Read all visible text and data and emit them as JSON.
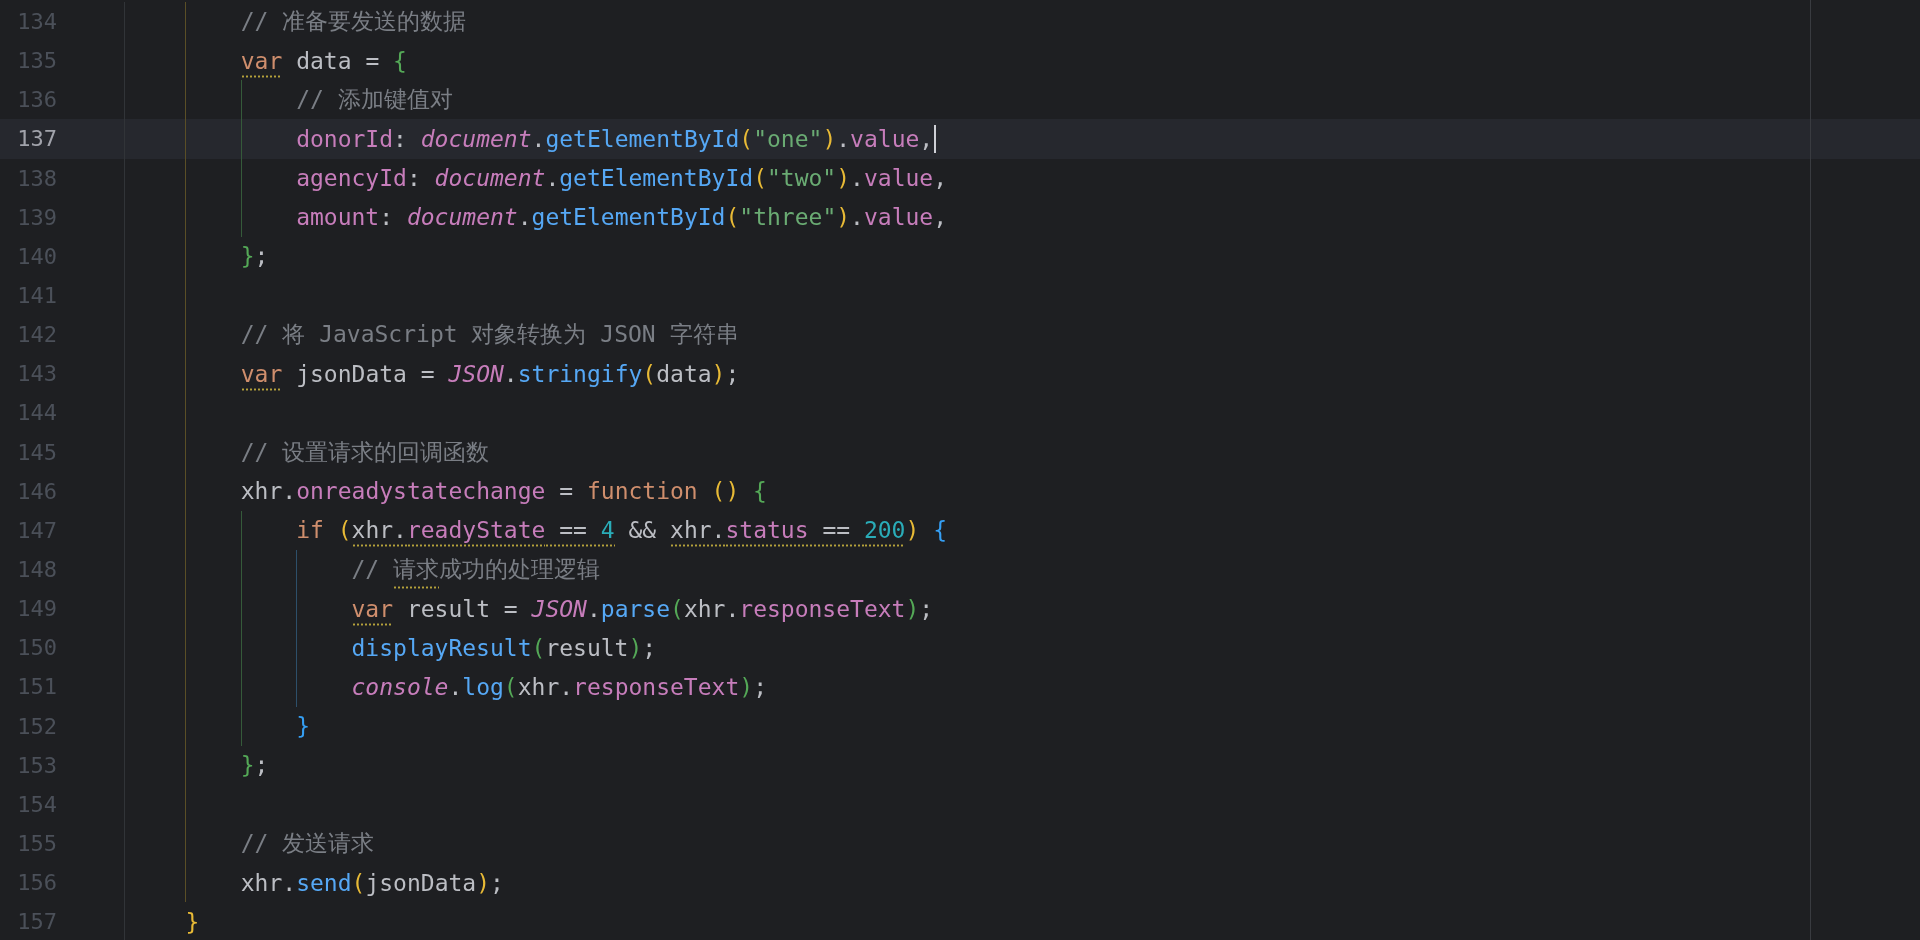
{
  "function_body": {
    "lines": [
      {
        "number": "134",
        "current": false,
        "tokens": [
          {
            "kind": "comment",
            "text": "// 准备要发送的数据",
            "warn": false
          }
        ]
      },
      {
        "number": "135",
        "current": false,
        "tokens": [
          {
            "kind": "keyword",
            "text": "var",
            "warn": true
          },
          {
            "kind": "plain",
            "text": " data = ",
            "warn": false
          },
          {
            "kind": "paren2",
            "text": "{",
            "warn": false
          }
        ],
        "children": [
          {
            "number": "136",
            "current": false,
            "tokens": [
              {
                "kind": "comment",
                "text": "// 添加键值对",
                "warn": false
              }
            ]
          },
          {
            "number": "137",
            "current": true,
            "tokens": [
              {
                "kind": "field",
                "text": "donorId",
                "warn": false
              },
              {
                "kind": "plain",
                "text": ": ",
                "warn": false
              },
              {
                "kind": "global",
                "text": "document",
                "warn": false
              },
              {
                "kind": "plain",
                "text": ".",
                "warn": false
              },
              {
                "kind": "method",
                "text": "getElementById",
                "warn": false
              },
              {
                "kind": "paren1",
                "text": "(",
                "warn": false
              },
              {
                "kind": "string",
                "text": "\"one\"",
                "warn": false
              },
              {
                "kind": "paren1",
                "text": ")",
                "warn": false
              },
              {
                "kind": "plain",
                "text": ".",
                "warn": false
              },
              {
                "kind": "field",
                "text": "value",
                "warn": false
              },
              {
                "kind": "plain",
                "text": ",",
                "warn": false
              }
            ]
          },
          {
            "number": "138",
            "current": false,
            "tokens": [
              {
                "kind": "field",
                "text": "agencyId",
                "warn": false
              },
              {
                "kind": "plain",
                "text": ": ",
                "warn": false
              },
              {
                "kind": "global",
                "text": "document",
                "warn": false
              },
              {
                "kind": "plain",
                "text": ".",
                "warn": false
              },
              {
                "kind": "method",
                "text": "getElementById",
                "warn": false
              },
              {
                "kind": "paren1",
                "text": "(",
                "warn": false
              },
              {
                "kind": "string",
                "text": "\"two\"",
                "warn": false
              },
              {
                "kind": "paren1",
                "text": ")",
                "warn": false
              },
              {
                "kind": "plain",
                "text": ".",
                "warn": false
              },
              {
                "kind": "field",
                "text": "value",
                "warn": false
              },
              {
                "kind": "plain",
                "text": ",",
                "warn": false
              }
            ]
          },
          {
            "number": "139",
            "current": false,
            "tokens": [
              {
                "kind": "field",
                "text": "amount",
                "warn": false
              },
              {
                "kind": "plain",
                "text": ": ",
                "warn": false
              },
              {
                "kind": "global",
                "text": "document",
                "warn": false
              },
              {
                "kind": "plain",
                "text": ".",
                "warn": false
              },
              {
                "kind": "method",
                "text": "getElementById",
                "warn": false
              },
              {
                "kind": "paren1",
                "text": "(",
                "warn": false
              },
              {
                "kind": "string",
                "text": "\"three\"",
                "warn": false
              },
              {
                "kind": "paren1",
                "text": ")",
                "warn": false
              },
              {
                "kind": "plain",
                "text": ".",
                "warn": false
              },
              {
                "kind": "field",
                "text": "value",
                "warn": false
              },
              {
                "kind": "plain",
                "text": ",",
                "warn": false
              }
            ]
          }
        ]
      },
      {
        "number": "140",
        "current": false,
        "tokens": [
          {
            "kind": "paren2",
            "text": "}",
            "warn": false
          },
          {
            "kind": "plain",
            "text": ";",
            "warn": false
          }
        ]
      },
      {
        "number": "141",
        "current": false
      },
      {
        "number": "142",
        "current": false,
        "tokens": [
          {
            "kind": "comment",
            "text": "// 将 JavaScript 对象转换为 JSON 字符串",
            "warn": false
          }
        ]
      },
      {
        "number": "143",
        "current": false,
        "tokens": [
          {
            "kind": "keyword",
            "text": "var",
            "warn": true
          },
          {
            "kind": "plain",
            "text": " jsonData = ",
            "warn": false
          },
          {
            "kind": "global",
            "text": "JSON",
            "warn": false
          },
          {
            "kind": "plain",
            "text": ".",
            "warn": false
          },
          {
            "kind": "method",
            "text": "stringify",
            "warn": false
          },
          {
            "kind": "paren1",
            "text": "(",
            "warn": false
          },
          {
            "kind": "plain",
            "text": "data",
            "warn": false
          },
          {
            "kind": "paren1",
            "text": ")",
            "warn": false
          },
          {
            "kind": "plain",
            "text": ";",
            "warn": false
          }
        ]
      },
      {
        "number": "144",
        "current": false
      },
      {
        "number": "145",
        "current": false,
        "tokens": [
          {
            "kind": "comment",
            "text": "// 设置请求的回调函数",
            "warn": false
          }
        ]
      },
      {
        "number": "146",
        "current": false,
        "tokens": [
          {
            "kind": "plain",
            "text": "xhr.",
            "warn": false
          },
          {
            "kind": "field",
            "text": "onreadystatechange",
            "warn": false
          },
          {
            "kind": "plain",
            "text": " = ",
            "warn": false
          },
          {
            "kind": "keyword",
            "text": "function",
            "warn": false
          },
          {
            "kind": "paren1",
            "text": " ()",
            "warn": false
          },
          {
            "kind": "paren2",
            "text": " {",
            "warn": false
          }
        ],
        "children": [
          {
            "number": "147",
            "current": false,
            "tokens": [
              {
                "kind": "keyword",
                "text": "if",
                "warn": false
              },
              {
                "kind": "paren1",
                "text": " (",
                "warn": false
              },
              {
                "kind": "plain",
                "text": "xhr.",
                "warn": true
              },
              {
                "kind": "field",
                "text": "readyState",
                "warn": true
              },
              {
                "kind": "plain",
                "text": " == ",
                "warn": true
              },
              {
                "kind": "number",
                "text": "4",
                "warn": true
              },
              {
                "kind": "plain",
                "text": " && ",
                "warn": false
              },
              {
                "kind": "plain",
                "text": "xhr.",
                "warn": true
              },
              {
                "kind": "field",
                "text": "status",
                "warn": true
              },
              {
                "kind": "plain",
                "text": " == ",
                "warn": true
              },
              {
                "kind": "number",
                "text": "200",
                "warn": true
              },
              {
                "kind": "paren1",
                "text": ")",
                "warn": false
              },
              {
                "kind": "paren3",
                "text": " {",
                "warn": false
              }
            ],
            "children": [
              {
                "number": "148",
                "current": false,
                "tokens": [
                  {
                    "kind": "comment",
                    "text": "// ",
                    "warn": false
                  },
                  {
                    "kind": "comment",
                    "text": "请求",
                    "warn": true
                  },
                  {
                    "kind": "comment",
                    "text": "成功的处理逻辑",
                    "warn": false
                  }
                ]
              },
              {
                "number": "149",
                "current": false,
                "tokens": [
                  {
                    "kind": "keyword",
                    "text": "var",
                    "warn": true
                  },
                  {
                    "kind": "plain",
                    "text": " result = ",
                    "warn": false
                  },
                  {
                    "kind": "global",
                    "text": "JSON",
                    "warn": false
                  },
                  {
                    "kind": "plain",
                    "text": ".",
                    "warn": false
                  },
                  {
                    "kind": "method",
                    "text": "parse",
                    "warn": false
                  },
                  {
                    "kind": "paren2",
                    "text": "(",
                    "warn": false
                  },
                  {
                    "kind": "plain",
                    "text": "xhr.",
                    "warn": false
                  },
                  {
                    "kind": "field",
                    "text": "responseText",
                    "warn": false
                  },
                  {
                    "kind": "paren2",
                    "text": ")",
                    "warn": false
                  },
                  {
                    "kind": "plain",
                    "text": ";",
                    "warn": false
                  }
                ]
              },
              {
                "number": "150",
                "current": false,
                "tokens": [
                  {
                    "kind": "method",
                    "text": "displayResult",
                    "warn": false
                  },
                  {
                    "kind": "paren2",
                    "text": "(",
                    "warn": false
                  },
                  {
                    "kind": "plain",
                    "text": "result",
                    "warn": false
                  },
                  {
                    "kind": "paren2",
                    "text": ")",
                    "warn": false
                  },
                  {
                    "kind": "plain",
                    "text": ";",
                    "warn": false
                  }
                ]
              },
              {
                "number": "151",
                "current": false,
                "tokens": [
                  {
                    "kind": "global",
                    "text": "console",
                    "warn": false
                  },
                  {
                    "kind": "plain",
                    "text": ".",
                    "warn": false
                  },
                  {
                    "kind": "method",
                    "text": "log",
                    "warn": false
                  },
                  {
                    "kind": "paren2",
                    "text": "(",
                    "warn": false
                  },
                  {
                    "kind": "plain",
                    "text": "xhr.",
                    "warn": false
                  },
                  {
                    "kind": "field",
                    "text": "responseText",
                    "warn": false
                  },
                  {
                    "kind": "paren2",
                    "text": ")",
                    "warn": false
                  },
                  {
                    "kind": "plain",
                    "text": ";",
                    "warn": false
                  }
                ]
              }
            ]
          },
          {
            "number": "152",
            "current": false,
            "tokens": [
              {
                "kind": "paren3",
                "text": "}",
                "warn": false
              }
            ]
          }
        ]
      },
      {
        "number": "153",
        "current": false,
        "tokens": [
          {
            "kind": "paren2",
            "text": "}",
            "warn": false
          },
          {
            "kind": "plain",
            "text": ";",
            "warn": false
          }
        ]
      },
      {
        "number": "154",
        "current": false
      },
      {
        "number": "155",
        "current": false,
        "tokens": [
          {
            "kind": "comment",
            "text": "// 发送请求",
            "warn": false
          }
        ]
      },
      {
        "number": "156",
        "current": false,
        "tokens": [
          {
            "kind": "plain",
            "text": "xhr.",
            "warn": false
          },
          {
            "kind": "method",
            "text": "send",
            "warn": false
          },
          {
            "kind": "paren1",
            "text": "(",
            "warn": false
          },
          {
            "kind": "plain",
            "text": "jsonData",
            "warn": false
          },
          {
            "kind": "paren1",
            "text": ")",
            "warn": false
          },
          {
            "kind": "plain",
            "text": ";",
            "warn": false
          }
        ]
      }
    ]
  },
  "closing_line": {
    "number": "157",
    "current": false,
    "tokens": [
      {
        "kind": "paren1",
        "text": "}",
        "warn": false
      }
    ]
  }
}
